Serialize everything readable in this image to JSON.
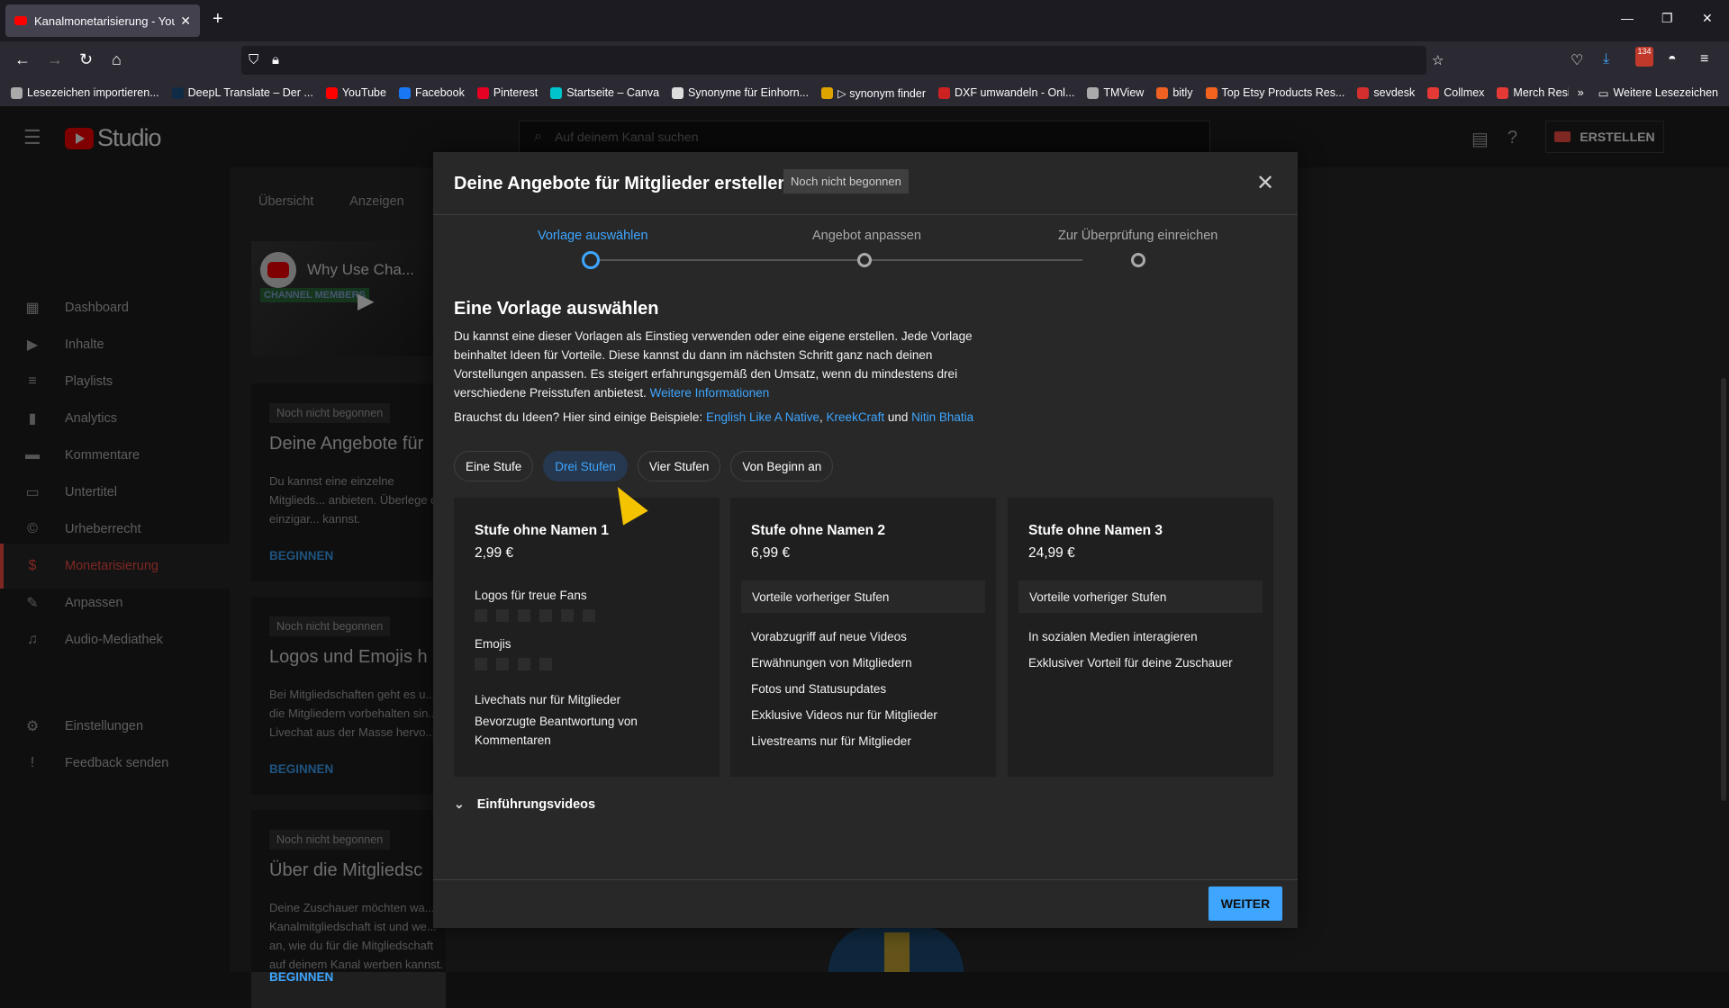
{
  "browser": {
    "tab_title": "Kanalmonetarisierung - YouTube",
    "tab_close": "✕",
    "new_tab": "+",
    "downloads_badge": "134",
    "bookmarks": [
      {
        "label": "Lesezeichen importieren...",
        "color": "#aaaaaa"
      },
      {
        "label": "DeepL Translate – Der ...",
        "color": "#0f2b46"
      },
      {
        "label": "YouTube",
        "color": "#ff0000"
      },
      {
        "label": "Facebook",
        "color": "#1877f2"
      },
      {
        "label": "Pinterest",
        "color": "#e60023"
      },
      {
        "label": "Startseite – Canva",
        "color": "#00c4cc"
      },
      {
        "label": "Synonyme für Einhorn...",
        "color": "#dddddd"
      },
      {
        "label": "▷ synonym finder",
        "color": "#e0a400"
      },
      {
        "label": "DXF umwandeln - Onl...",
        "color": "#cc2222"
      },
      {
        "label": "TMView",
        "color": "#aaaaaa"
      },
      {
        "label": "bitly",
        "color": "#ee6123"
      },
      {
        "label": "Top Etsy Products Res...",
        "color": "#f1641e"
      },
      {
        "label": "sevdesk",
        "color": "#d32f2f"
      },
      {
        "label": "Collmex",
        "color": "#e53935"
      },
      {
        "label": "Merch Resize by Greg",
        "color": "#e53935"
      }
    ],
    "bookmarks_more": "Weitere Lesezeichen"
  },
  "header": {
    "logo_text": "Studio",
    "search_placeholder": "Auf deinem Kanal suchen",
    "create_label": "ERSTELLEN"
  },
  "sidebar": {
    "items": [
      {
        "label": "Dashboard",
        "icon": "▦"
      },
      {
        "label": "Inhalte",
        "icon": "▶"
      },
      {
        "label": "Playlists",
        "icon": "≡"
      },
      {
        "label": "Analytics",
        "icon": "▮"
      },
      {
        "label": "Kommentare",
        "icon": "▬"
      },
      {
        "label": "Untertitel",
        "icon": "▭"
      },
      {
        "label": "Urheberrecht",
        "icon": "©"
      },
      {
        "label": "Monetarisierung",
        "icon": "$"
      },
      {
        "label": "Anpassen",
        "icon": "✎"
      },
      {
        "label": "Audio-Mediathek",
        "icon": "♫"
      }
    ],
    "bottom": [
      {
        "label": "Einstellungen",
        "icon": "⚙"
      },
      {
        "label": "Feedback senden",
        "icon": "!"
      }
    ]
  },
  "background": {
    "tabs": [
      "Übersicht",
      "Anzeigen"
    ],
    "thumb_title": "Why Use Cha...",
    "thumb_badge": "CHANNEL MEMBERS",
    "cards": [
      {
        "status": "Noch nicht begonnen",
        "title": "Deine Angebote für",
        "desc": "Du kannst eine einzelne Mitglieds... anbieten. Überlege dir einzigar... kannst.",
        "button": "BEGINNEN"
      },
      {
        "status": "Noch nicht begonnen",
        "title": "Logos und Emojis h",
        "desc": "Bei Mitgliedschaften geht es u... die Mitgliedern vorbehalten sin... Livechat aus der Masse hervo...",
        "button": "BEGINNEN"
      },
      {
        "status": "Noch nicht begonnen",
        "title": "Über die Mitgliedsc",
        "desc": "Deine Zuschauer möchten wa... Kanalmitgliedschaft ist und we... an, wie du für die Mitgliedschaft auf deinem Kanal werben kannst.",
        "button": "BEGINNEN"
      }
    ]
  },
  "modal": {
    "title": "Deine Angebote für Mitglieder erstellen",
    "status": "Noch nicht begonnen",
    "steps": [
      "Vorlage auswählen",
      "Angebot anpassen",
      "Zur Überprüfung einreichen"
    ],
    "heading": "Eine Vorlage auswählen",
    "description": "Du kannst eine dieser Vorlagen als Einstieg verwenden oder eine eigene erstellen. Jede Vorlage beinhaltet Ideen für Vorteile. Diese kannst du dann im nächsten Schritt ganz nach deinen Vorstellungen anpassen. Es steigert erfahrungsgemäß den Umsatz, wenn du mindestens drei verschiedene Preisstufen anbietest.",
    "more_info": "Weitere Informationen",
    "ideas_prefix": "Brauchst du Ideen? Hier sind einige Beispiele:",
    "ideas_links": [
      "English Like A Native",
      "KreekCraft",
      "Nitin Bhatia"
    ],
    "ideas_comma": ",",
    "ideas_and": "und",
    "chips": [
      "Eine Stufe",
      "Drei Stufen",
      "Vier Stufen",
      "Von Beginn an"
    ],
    "tiers": [
      {
        "name": "Stufe ohne Namen 1",
        "price": "2,99 €",
        "logos": "Logos für treue Fans",
        "emojis": "Emojis",
        "perks": [
          "Livechats nur für Mitglieder",
          "Bevorzugte Beantwortung von Kommentaren"
        ]
      },
      {
        "name": "Stufe ohne Namen 2",
        "price": "6,99 €",
        "prev": "Vorteile vorheriger Stufen",
        "perks": [
          "Vorabzugriff auf neue Videos",
          "Erwähnungen von Mitgliedern",
          "Fotos und Statusupdates",
          "Exklusive Videos nur für Mitglieder",
          "Livestreams nur für Mitglieder"
        ]
      },
      {
        "name": "Stufe ohne Namen 3",
        "price": "24,99 €",
        "prev": "Vorteile vorheriger Stufen",
        "perks": [
          "In sozialen Medien interagieren",
          "Exklusiver Vorteil für deine Zuschauer"
        ]
      }
    ],
    "intro_label": "Einführungsvideos",
    "next_label": "WEITER"
  }
}
